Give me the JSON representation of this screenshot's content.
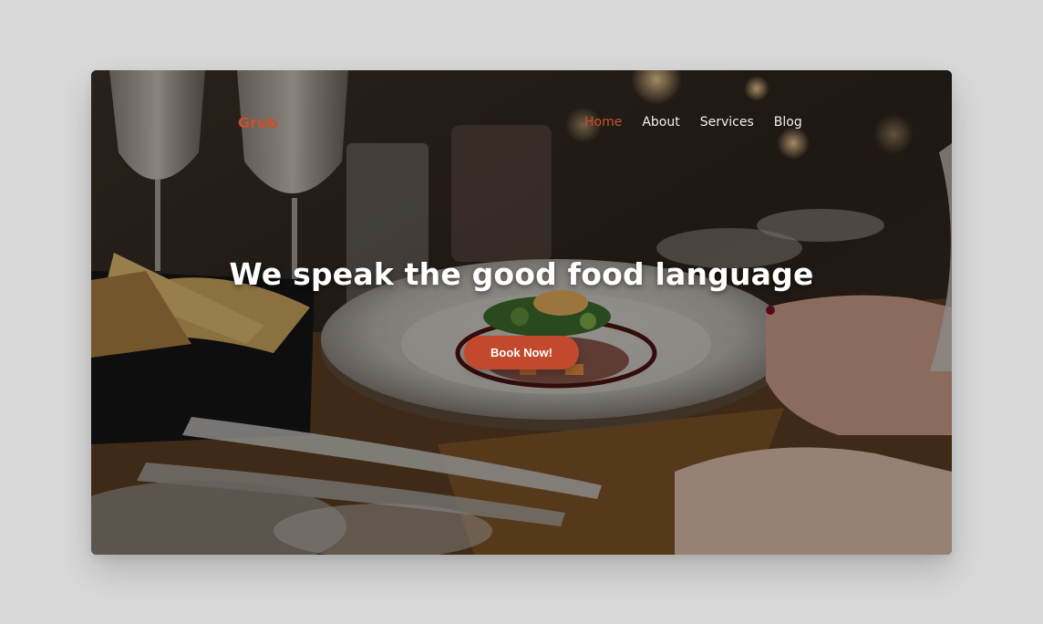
{
  "brand": {
    "name": "Grub",
    "accent_color": "#c8502f"
  },
  "nav": {
    "items": [
      {
        "label": "Home",
        "active": true
      },
      {
        "label": "About",
        "active": false
      },
      {
        "label": "Services",
        "active": false
      },
      {
        "label": "Blog",
        "active": false
      }
    ]
  },
  "hero": {
    "title": "We speak the good food language",
    "cta_label": "Book Now!",
    "cta_color": "#c2492c",
    "background_image": "restaurant-table-plated-dish"
  }
}
